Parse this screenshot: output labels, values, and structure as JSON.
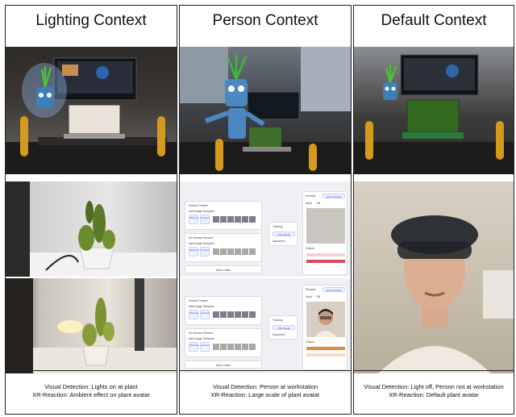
{
  "columns": [
    {
      "title": "Lighting Context",
      "caption": {
        "line1": "Visual Detection: Lights on at plant",
        "line2": "XR-Reaction: Ambient effect on plant avatar"
      }
    },
    {
      "title": "Person Context",
      "caption": {
        "line1": "Visual Detection: Person at workstation",
        "line2": "XR-Reaction: Large scale of plant avatar"
      }
    },
    {
      "title": "Default Context",
      "caption": {
        "line1": "Visual Detection: Light off, Person not at workstation",
        "line2": "XR-Reaction: Default plant avatar"
      }
    }
  ],
  "ui_mock": {
    "class_a": "Human Present",
    "class_b": "No Human Present",
    "image_samples": "Add Image Samples:",
    "webcam": "Webcam",
    "upload": "Upload",
    "training": "Training",
    "train_model": "Train Model",
    "advanced": "Advanced",
    "add_class": "Add a class",
    "preview": "Preview",
    "export_model": "Export Model",
    "input": "Input",
    "on": "ON",
    "output": "Output"
  }
}
